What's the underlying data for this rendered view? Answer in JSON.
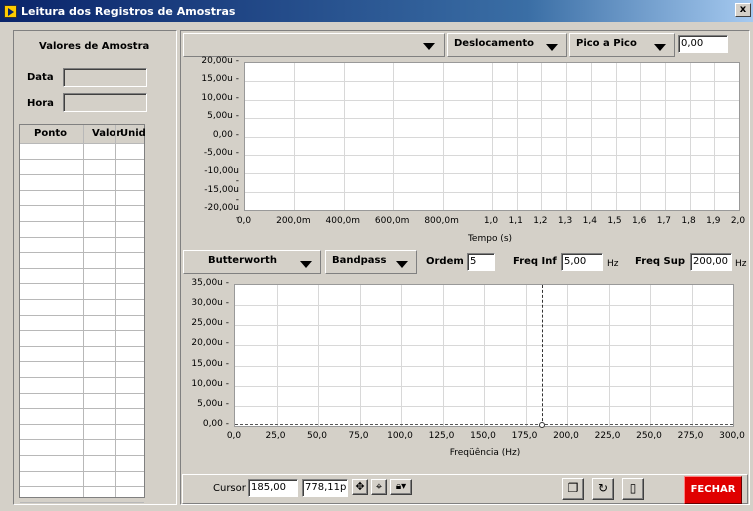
{
  "window": {
    "title": "Leitura dos Registros de Amostras",
    "close_label": "x"
  },
  "left": {
    "heading": "Valores de Amostra",
    "data_label": "Data",
    "hora_label": "Hora",
    "data_value": "",
    "hora_value": "",
    "table": {
      "columns": [
        "Ponto",
        "Valor",
        "Unid"
      ],
      "rows": []
    }
  },
  "top_controls": {
    "channel_value": "",
    "measure_value": "Deslocamento",
    "mode_value": "Pico a Pico",
    "result_value": "0,00"
  },
  "chart_top": {
    "type": "line",
    "xlabel": "Tempo (s)",
    "ylabel": "",
    "yticks": [
      "20,00u",
      "15,00u",
      "10,00u",
      "5,00u",
      "0,00",
      "-5,00u",
      "-10,00u",
      "-15,00u",
      "-20,00u"
    ],
    "xticks": [
      "0,0",
      "200,0m",
      "400,0m",
      "600,0m",
      "800,0m",
      "1,0",
      "1,1",
      "1,2",
      "1,3",
      "1,4",
      "1,5",
      "1,6",
      "1,7",
      "1,8",
      "1,9",
      "2,0"
    ],
    "series": []
  },
  "filter": {
    "type_value": "Butterworth",
    "band_value": "Bandpass",
    "ordem_label": "Ordem",
    "ordem_value": "5",
    "freq_inf_label": "Freq Inf",
    "freq_inf_value": "5,00",
    "freq_inf_unit": "Hz",
    "freq_sup_label": "Freq Sup",
    "freq_sup_value": "200,00",
    "freq_sup_unit": "Hz"
  },
  "chart_bottom": {
    "type": "line",
    "xlabel": "Freqüência (Hz)",
    "ylabel": "",
    "yticks": [
      "35,00u",
      "30,00u",
      "25,00u",
      "20,00u",
      "15,00u",
      "10,00u",
      "5,00u",
      "0,00"
    ],
    "xticks": [
      "0,0",
      "25,0",
      "50,0",
      "75,0",
      "100,0",
      "125,0",
      "150,0",
      "175,0",
      "200,0",
      "225,0",
      "250,0",
      "275,0",
      "300,0"
    ],
    "xlim": [
      0,
      300
    ],
    "ylim": [
      0,
      35
    ],
    "cursor_x": 185.0,
    "series": []
  },
  "chart_data": [
    {
      "type": "line",
      "xlabel": "Tempo (s)",
      "ylabel": "",
      "xlim": [
        0,
        2.0
      ],
      "ylim": [
        -20,
        20
      ],
      "series": []
    },
    {
      "type": "line",
      "xlabel": "Freqüência (Hz)",
      "ylabel": "",
      "xlim": [
        0,
        300
      ],
      "ylim": [
        0,
        35
      ],
      "series": [
        {
          "x": [
            0,
            300
          ],
          "y": [
            0,
            0
          ]
        }
      ]
    }
  ],
  "footer": {
    "cursor_label": "Cursor",
    "cursor_x": "185,00",
    "cursor_y": "778,11p",
    "close_button": "FECHAR"
  }
}
